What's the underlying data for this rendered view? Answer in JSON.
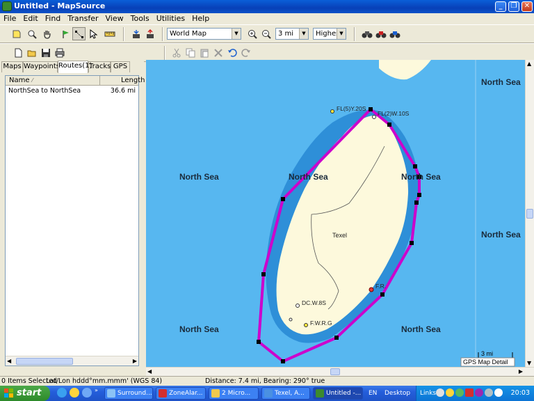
{
  "window": {
    "title": "Untitled - MapSource"
  },
  "menu": [
    "File",
    "Edit",
    "Find",
    "Transfer",
    "View",
    "Tools",
    "Utilities",
    "Help"
  ],
  "toolbar": {
    "product_select": "World Map",
    "zoom_select": "3 mi",
    "detail_select": "Highest"
  },
  "tabs": [
    "Maps",
    "Waypoints",
    "Routes(1)",
    "Tracks",
    "GPS"
  ],
  "routes_list": {
    "columns": [
      "Name",
      "Length"
    ],
    "rows": [
      {
        "name": "NorthSea to NorthSea",
        "length": "36.6 mi"
      }
    ]
  },
  "map": {
    "sea_labels": [
      "North Sea",
      "North Sea",
      "North Sea",
      "North Sea",
      "North Sea",
      "North Sea",
      "North Sea"
    ],
    "island_label": "Texel",
    "light_labels": [
      "FL(5)Y.20S",
      "FL(2)W.10S",
      "DC.W.8S",
      "F.W.R.G",
      "F.R."
    ],
    "scale_label": "3 mi",
    "detail_badge": "GPS Map Detail",
    "colors": {
      "sea": "#57B7F0",
      "land": "#FDF9DC",
      "shallow": "#2E8FD8",
      "route": "#CC00CC"
    }
  },
  "status": {
    "selection": "0 Items Selected",
    "format": "Lat/Lon hddd°mm.mmm' (WGS 84)",
    "distance": "Distance: 7.4 mi, Bearing: 290° true"
  },
  "taskbar": {
    "start": "start",
    "tasks": [
      "Surround...",
      "ZoneAlar...",
      "2 Micro...",
      "Texel, A...",
      "Untitled -..."
    ],
    "lang": "EN",
    "desktop": "Desktop",
    "links": "Links",
    "clock": "20:03"
  }
}
